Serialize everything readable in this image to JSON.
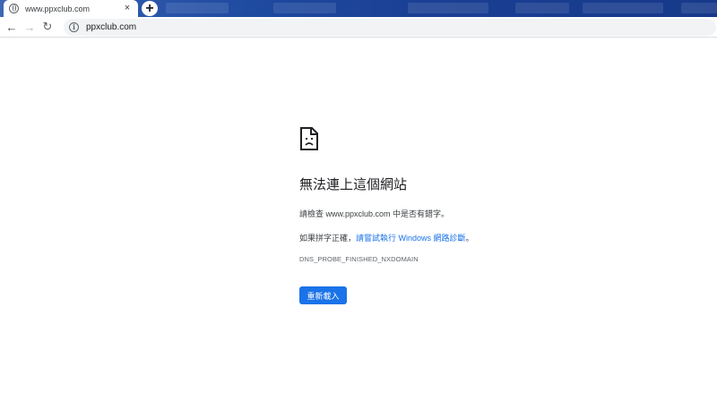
{
  "browser": {
    "tab_title": "www.ppxclub.com",
    "tab_close": "×",
    "new_tab": "+",
    "back": "←",
    "forward": "→",
    "reload": "↻",
    "info": "i",
    "url": "ppxclub.com"
  },
  "error": {
    "heading": "無法連上這個網站",
    "check_prefix": "請檢查 www.ppxclub.com 中是否有錯字。",
    "hint_prefix": "如果拼字正確，",
    "hint_link": "請嘗試執行 Windows 網路診斷",
    "hint_suffix": "。",
    "code": "DNS_PROBE_FINISHED_NXDOMAIN",
    "reload_button": "重新載入"
  },
  "colors": {
    "accent": "#1a73e8",
    "titlebar": "#1e4aa0"
  }
}
